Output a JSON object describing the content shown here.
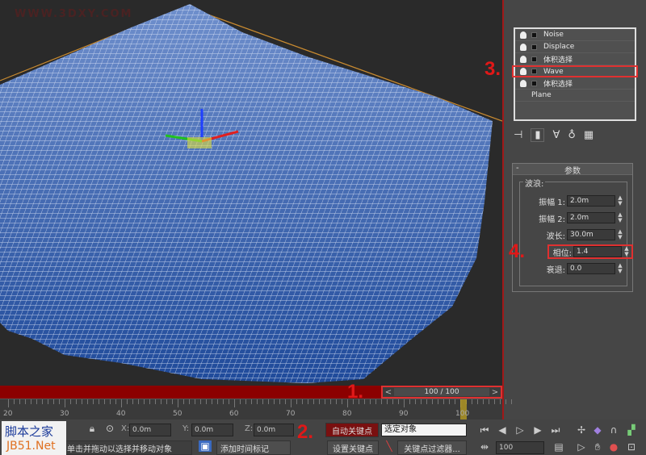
{
  "watermark": "WWW.3DXY.COM",
  "site_logo": {
    "line1": "脚本之家",
    "line2": "JB51.Net"
  },
  "modifier_stack": [
    {
      "label": "Noise"
    },
    {
      "label": "Displace"
    },
    {
      "label": "体积选择"
    },
    {
      "label": "Wave"
    },
    {
      "label": "体积选择"
    }
  ],
  "base_object": "Plane",
  "rollout": {
    "title": "参数",
    "collapse": "-",
    "group": "波浪:",
    "params": [
      {
        "label": "振幅 1:",
        "value": "2.0m"
      },
      {
        "label": "振幅 2:",
        "value": "2.0m"
      },
      {
        "label": "波长:",
        "value": "30.0m"
      },
      {
        "label": "相位:",
        "value": "1.4"
      },
      {
        "label": "衰退:",
        "value": "0.0"
      }
    ]
  },
  "timeline": {
    "frame": "100 / 100",
    "prev": "<",
    "next": ">",
    "ticks": [
      "20",
      "30",
      "40",
      "50",
      "60",
      "70",
      "80",
      "90",
      "100"
    ]
  },
  "coords": {
    "x_label": "X:",
    "x": "0.0m",
    "y_label": "Y:",
    "y": "0.0m",
    "z_label": "Z:",
    "z": "0.0m"
  },
  "status": {
    "prompt": "单击并拖动以选择并移动对象",
    "add_tag": "添加时间标记"
  },
  "anim": {
    "auto_key": "自动关键点",
    "set_key": "设置关键点",
    "selection": "选定对象",
    "key_filters": "关键点过滤器...",
    "frame": "100"
  },
  "annotations": [
    "1.",
    "2.",
    "3.",
    "4."
  ],
  "colors": {
    "accent_red": "#e03030",
    "mesh_blue": "#2f5fa8"
  }
}
